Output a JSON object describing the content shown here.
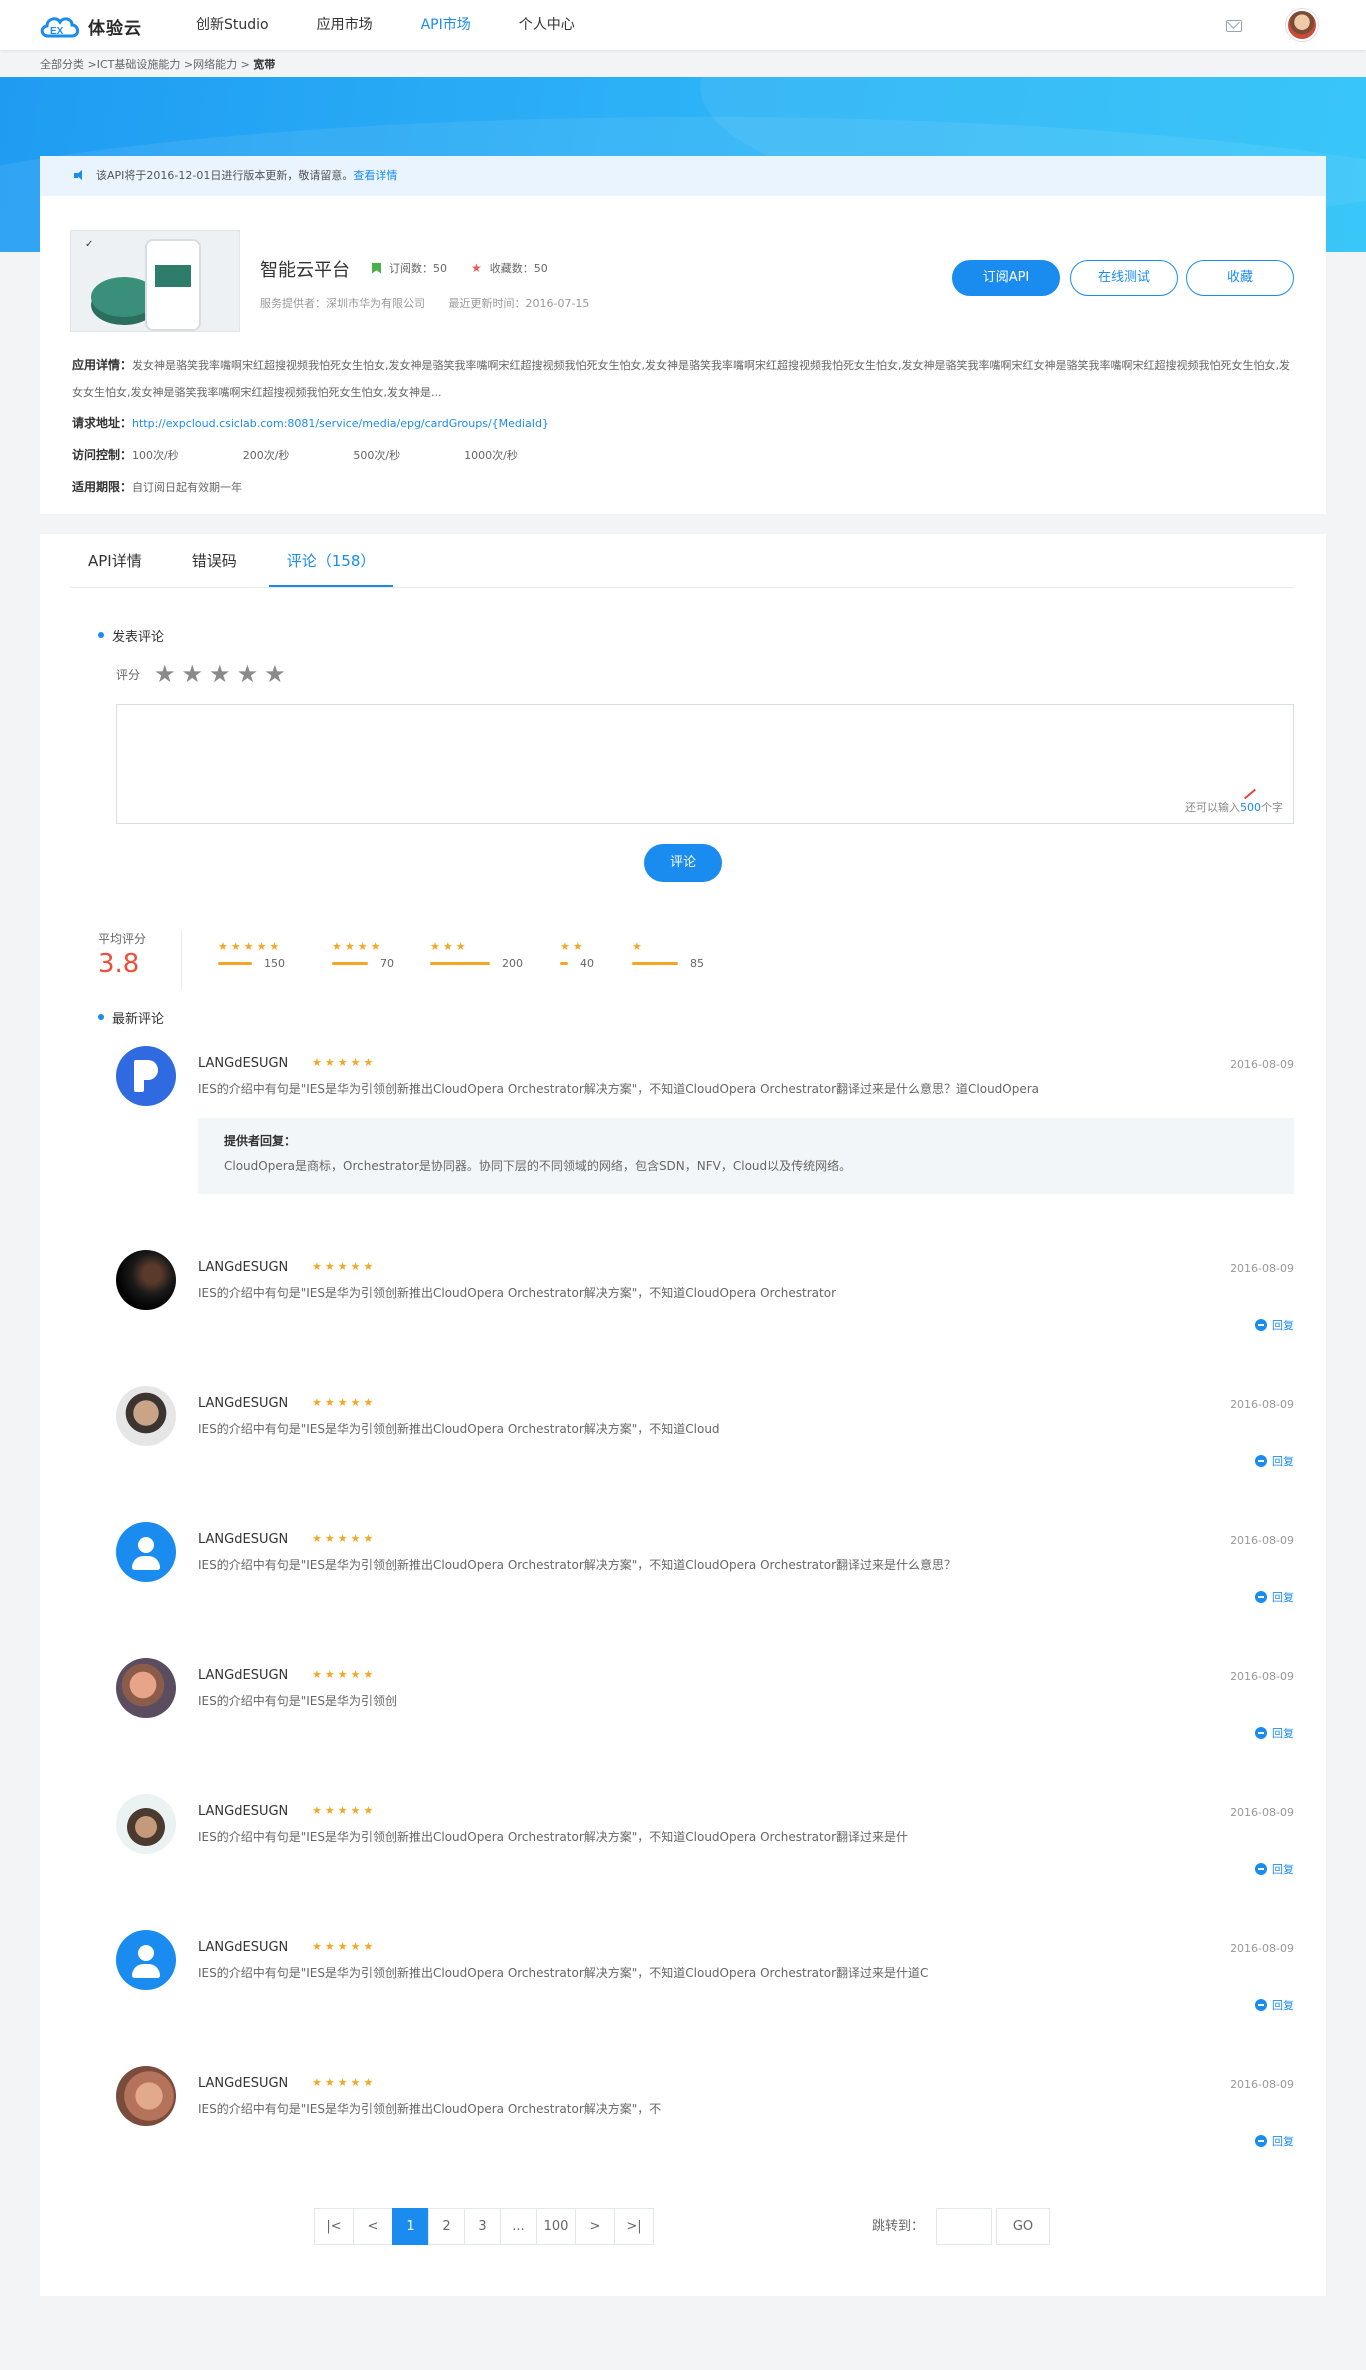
{
  "topbar": {
    "logo_text": "体验云",
    "nav": [
      "创新Studio",
      "应用市场",
      "API市场",
      "个人中心"
    ],
    "active_nav": 2
  },
  "breadcrumb": {
    "path": "全部分类 >ICT基础设施能力 >网络能力 > ",
    "current": "宽带"
  },
  "notice": {
    "text": "该API将于2016-12-01日进行版本更新，敬请留意。",
    "link": "查看详情"
  },
  "app": {
    "title": "智能云平台",
    "subscribe_count": "订阅数：50",
    "favorite_count": "收藏数：50",
    "provider": "服务提供者：深圳市华为有限公司",
    "updated": "最近更新时间：2016-07-15",
    "btn_subscribe": "订阅API",
    "btn_test": "在线测试",
    "btn_favorite": "收藏",
    "desc_label": "应用详情：",
    "desc": "发女神是骆笑我率嘴啊宋红超搜视频我怕死女生怕女,发女神是骆笑我率嘴啊宋红超搜视频我怕死女生怕女,发女神是骆笑我率嘴啊宋红超搜视频我怕死女生怕女,发女神是骆笑我率嘴啊宋红女神是骆笑我率嘴啊宋红超搜视频我怕死女生怕女,发女女生怕女,发女神是骆笑我率嘴啊宋红超搜视频我怕死女生怕女,发女神是...",
    "url_label": "请求地址：",
    "url": "http://expcloud.csiclab.com:8081/service/media/epg/cardGroups/{MediaId}",
    "rate_label": "访问控制：",
    "rates": [
      "100次/秒",
      "200次/秒",
      "500次/秒",
      "1000次/秒"
    ],
    "expire_label": "适用期限：",
    "expire": "自订阅日起有效期一年"
  },
  "tabs": [
    "API详情",
    "错误码",
    "评论（158）"
  ],
  "active_tab": 2,
  "compose": {
    "section": "发表评论",
    "rating_label": "评分",
    "hint_prefix": "还可以输入",
    "hint_count": "500",
    "hint_suffix": "个字",
    "submit": "评论"
  },
  "summary": {
    "avg_label": "平均评分",
    "avg_value": "3.8",
    "distribution": [
      {
        "stars": "★★★★★",
        "count": "150"
      },
      {
        "stars": "★★★★",
        "count": "70"
      },
      {
        "stars": "★★★",
        "count": "200"
      },
      {
        "stars": "★★",
        "count": "40"
      },
      {
        "stars": "★",
        "count": "85"
      }
    ]
  },
  "latest_label": "最新评论",
  "comments": [
    {
      "name": "LANGdESUGN",
      "stars": "★★★★★",
      "date": "2016-08-09",
      "text": "IES的介绍中有句是\"IES是华为引领创新推出CloudOpera Orchestrator解决方案\"，不知道CloudOpera Orchestrator翻译过来是什么意思？道CloudOpera",
      "reply_title": "提供者回复：",
      "reply_text": "CloudOpera是商标，Orchestrator是协同器。协同下层的不同领域的网络，包含SDN，NFV，Cloud以及传统网络。"
    },
    {
      "name": "LANGdESUGN",
      "stars": "★★★★★",
      "date": "2016-08-09",
      "text": "IES的介绍中有句是\"IES是华为引领创新推出CloudOpera Orchestrator解决方案\"，不知道CloudOpera Orchestrator",
      "reply": "回复"
    },
    {
      "name": "LANGdESUGN",
      "stars": "★★★★★",
      "date": "2016-08-09",
      "text": "IES的介绍中有句是\"IES是华为引领创新推出CloudOpera Orchestrator解决方案\"，不知道Cloud",
      "reply": "回复"
    },
    {
      "name": "LANGdESUGN",
      "stars": "★★★★★",
      "date": "2016-08-09",
      "text": "IES的介绍中有句是\"IES是华为引领创新推出CloudOpera Orchestrator解决方案\"，不知道CloudOpera Orchestrator翻译过来是什么意思？",
      "reply": "回复"
    },
    {
      "name": "LANGdESUGN",
      "stars": "★★★★★",
      "date": "2016-08-09",
      "text": "IES的介绍中有句是\"IES是华为引领创",
      "reply": "回复"
    },
    {
      "name": "LANGdESUGN",
      "stars": "★★★★★",
      "date": "2016-08-09",
      "text": "IES的介绍中有句是\"IES是华为引领创新推出CloudOpera Orchestrator解决方案\"，不知道CloudOpera Orchestrator翻译过来是什",
      "reply": "回复"
    },
    {
      "name": "LANGdESUGN",
      "stars": "★★★★★",
      "date": "2016-08-09",
      "text": "IES的介绍中有句是\"IES是华为引领创新推出CloudOpera Orchestrator解决方案\"，不知道CloudOpera Orchestrator翻译过来是什道C",
      "reply": "回复"
    },
    {
      "name": "LANGdESUGN",
      "stars": "★★★★★",
      "date": "2016-08-09",
      "text": "IES的介绍中有句是\"IES是华为引领创新推出CloudOpera Orchestrator解决方案\"，不",
      "reply": "回复"
    }
  ],
  "pagination": {
    "first": "|<",
    "prev": "<",
    "pages": [
      "1",
      "2",
      "3",
      "...",
      "100"
    ],
    "active": 0,
    "next": ">",
    "last": ">|",
    "jump_label": "跳转到：",
    "go": "GO"
  },
  "colors": {
    "accent": "#1a8cf0",
    "star": "#f5a623",
    "score": "#f04d3b"
  }
}
